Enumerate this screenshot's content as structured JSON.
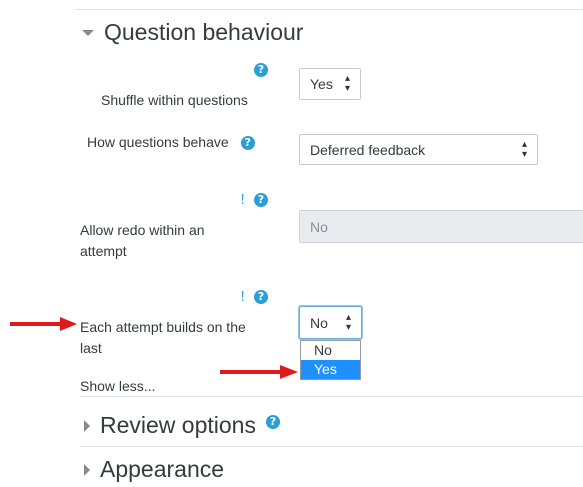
{
  "sections": {
    "question_behaviour": "Question behaviour",
    "review_options": "Review options",
    "appearance": "Appearance"
  },
  "fields": {
    "shuffle": {
      "label": "Shuffle within questions",
      "value": "Yes"
    },
    "how_behave": {
      "label": "How questions behave",
      "value": "Deferred feedback"
    },
    "allow_redo": {
      "label": "Allow redo within an attempt",
      "value": "No"
    },
    "each_attempt": {
      "label": "Each attempt builds on the last",
      "value": "No"
    }
  },
  "dropdown_options": [
    "No",
    "Yes"
  ],
  "dropdown_selected": "Yes",
  "show_less": "Show less...",
  "help_glyph": "?",
  "required_glyph": "!",
  "colors": {
    "help": "#2a9fd6",
    "arrow": "#e0191b",
    "selected_option": "#1e90ff"
  },
  "icons": [
    "chevron-down-icon",
    "chevron-right-icon",
    "help-icon",
    "exclamation-icon",
    "sort-arrows-icon",
    "red-arrow-annotation"
  ]
}
